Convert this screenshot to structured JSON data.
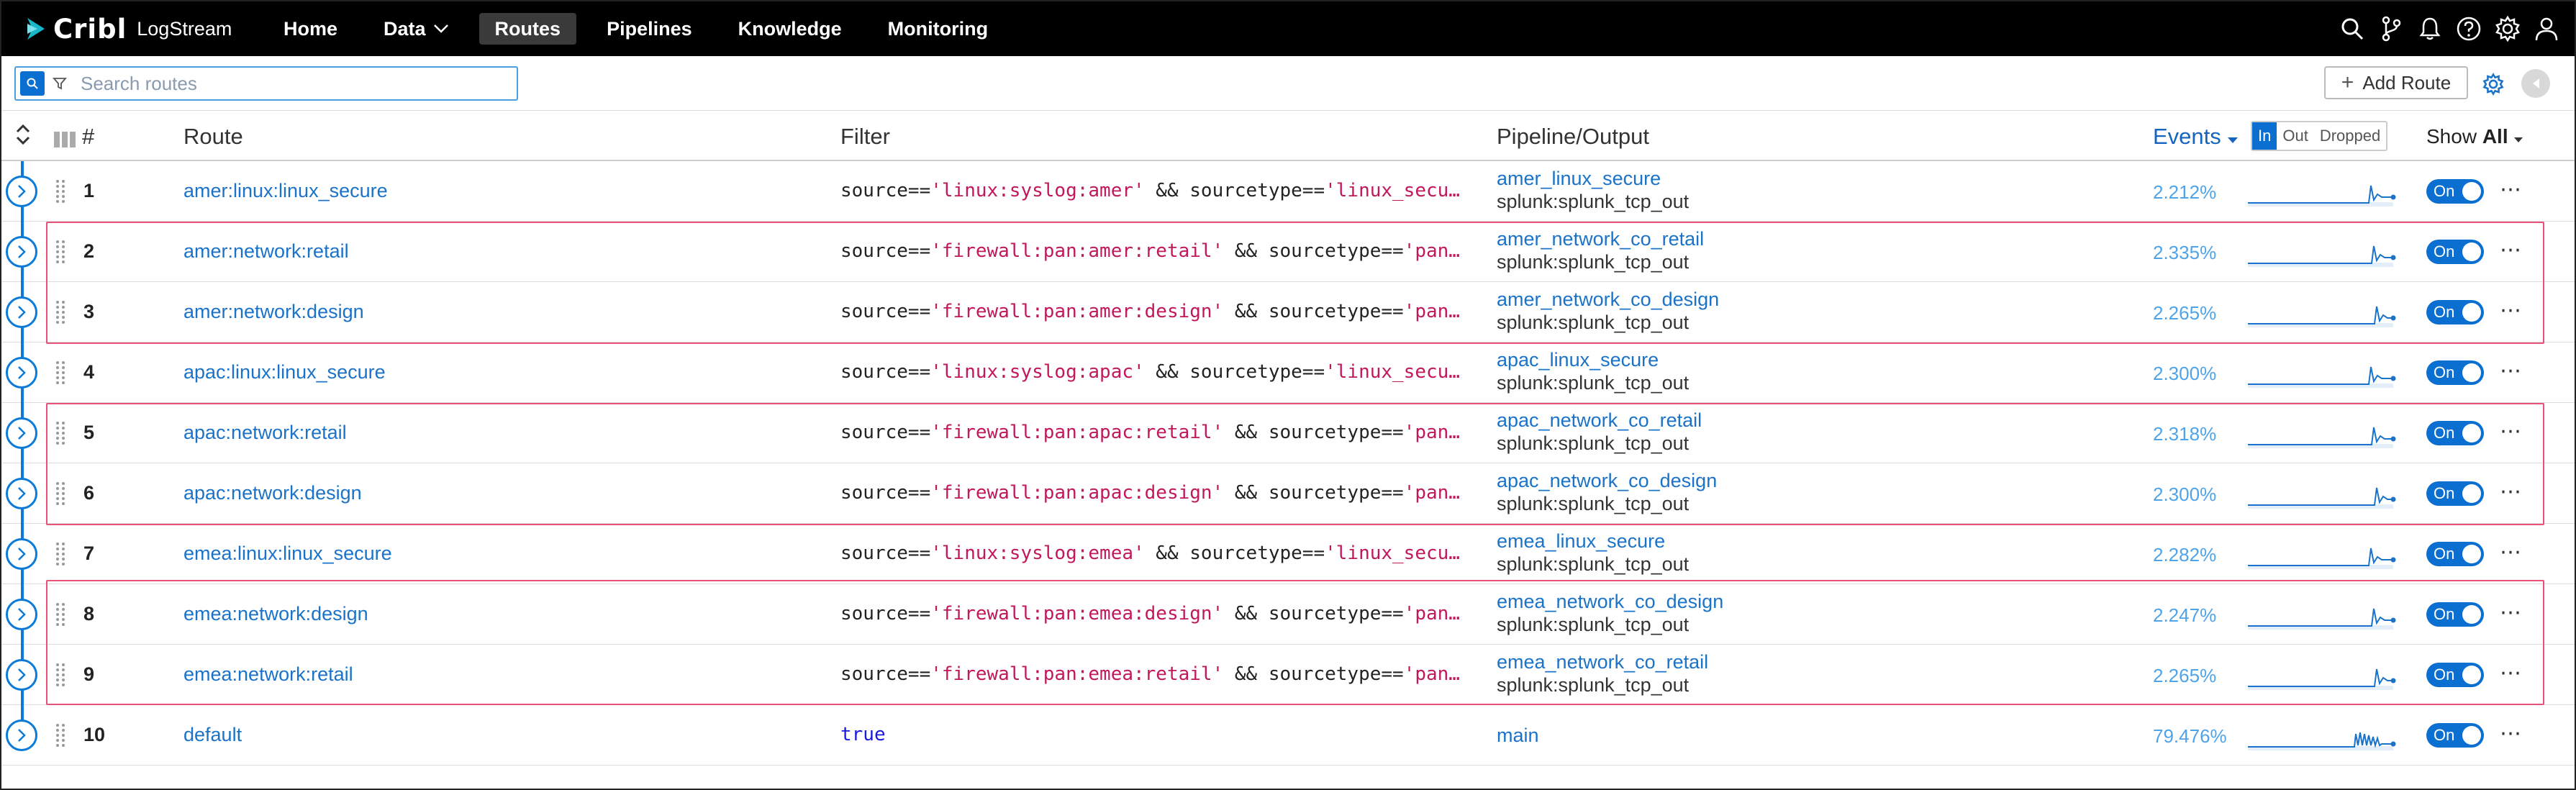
{
  "app": {
    "brand": "Cribl",
    "product": "LogStream"
  },
  "nav": {
    "home": "Home",
    "data": "Data",
    "routes": "Routes",
    "pipelines": "Pipelines",
    "knowledge": "Knowledge",
    "monitoring": "Monitoring"
  },
  "toolbar": {
    "search_placeholder": "Search routes",
    "add_route": "Add Route"
  },
  "columns": {
    "num": "#",
    "route": "Route",
    "filter": "Filter",
    "pipeline": "Pipeline/Output",
    "events": "Events"
  },
  "io_toggle": {
    "in": "In",
    "out": "Out",
    "dropped": "Dropped",
    "selected": "In"
  },
  "show": {
    "label": "Show",
    "value": "All"
  },
  "colors": {
    "accent": "#0a6fd0",
    "link": "#1a73c9",
    "highlight": "#e7527a",
    "string": "#c2185b"
  },
  "rows": [
    {
      "num": "1",
      "route": "amer:linux:linux_secure",
      "f1": "source==",
      "f2": "'linux:syslog:amer'",
      "f3": " && sourcetype==",
      "f4": "'linux_secu…",
      "pipeline": "amer_linux_secure",
      "output": "splunk:splunk_tcp_out",
      "pct": "2.212%",
      "toggle": "On"
    },
    {
      "num": "2",
      "route": "amer:network:retail",
      "f1": "source==",
      "f2": "'firewall:pan:amer:retail'",
      "f3": " && sourcetype==",
      "f4": "'pan…",
      "pipeline": "amer_network_co_retail",
      "output": "splunk:splunk_tcp_out",
      "pct": "2.335%",
      "toggle": "On"
    },
    {
      "num": "3",
      "route": "amer:network:design",
      "f1": "source==",
      "f2": "'firewall:pan:amer:design'",
      "f3": " && sourcetype==",
      "f4": "'pan…",
      "pipeline": "amer_network_co_design",
      "output": "splunk:splunk_tcp_out",
      "pct": "2.265%",
      "toggle": "On"
    },
    {
      "num": "4",
      "route": "apac:linux:linux_secure",
      "f1": "source==",
      "f2": "'linux:syslog:apac'",
      "f3": " && sourcetype==",
      "f4": "'linux_secu…",
      "pipeline": "apac_linux_secure",
      "output": "splunk:splunk_tcp_out",
      "pct": "2.300%",
      "toggle": "On"
    },
    {
      "num": "5",
      "route": "apac:network:retail",
      "f1": "source==",
      "f2": "'firewall:pan:apac:retail'",
      "f3": " && sourcetype==",
      "f4": "'pan…",
      "pipeline": "apac_network_co_retail",
      "output": "splunk:splunk_tcp_out",
      "pct": "2.318%",
      "toggle": "On"
    },
    {
      "num": "6",
      "route": "apac:network:design",
      "f1": "source==",
      "f2": "'firewall:pan:apac:design'",
      "f3": " && sourcetype==",
      "f4": "'pan…",
      "pipeline": "apac_network_co_design",
      "output": "splunk:splunk_tcp_out",
      "pct": "2.300%",
      "toggle": "On"
    },
    {
      "num": "7",
      "route": "emea:linux:linux_secure",
      "f1": "source==",
      "f2": "'linux:syslog:emea'",
      "f3": " && sourcetype==",
      "f4": "'linux_secu…",
      "pipeline": "emea_linux_secure",
      "output": "splunk:splunk_tcp_out",
      "pct": "2.282%",
      "toggle": "On"
    },
    {
      "num": "8",
      "route": "emea:network:design",
      "f1": "source==",
      "f2": "'firewall:pan:emea:design'",
      "f3": " && sourcetype==",
      "f4": "'pan…",
      "pipeline": "emea_network_co_design",
      "output": "splunk:splunk_tcp_out",
      "pct": "2.247%",
      "toggle": "On"
    },
    {
      "num": "9",
      "route": "emea:network:retail",
      "f1": "source==",
      "f2": "'firewall:pan:emea:retail'",
      "f3": " && sourcetype==",
      "f4": "'pan…",
      "pipeline": "emea_network_co_retail",
      "output": "splunk:splunk_tcp_out",
      "pct": "2.265%",
      "toggle": "On"
    },
    {
      "num": "10",
      "route": "default",
      "f1": "",
      "f2": "",
      "f3": "",
      "f4": "",
      "fkw": "true",
      "pipeline": "main",
      "output": "",
      "pct": "79.476%",
      "toggle": "On"
    }
  ]
}
